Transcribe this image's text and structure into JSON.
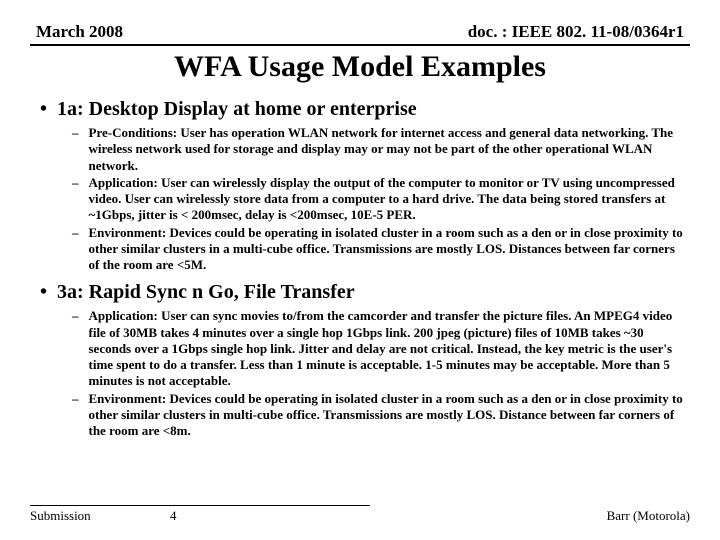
{
  "header": {
    "date": "March 2008",
    "doc": "doc. : IEEE 802. 11-08/0364r1"
  },
  "title": "WFA Usage Model Examples",
  "sections": [
    {
      "heading": "1a: Desktop Display at home or enterprise",
      "items": [
        "Pre-Conditions: User has operation WLAN network for internet access and general data networking. The wireless network used for storage and display may or may not be part of the other operational WLAN network.",
        "Application: User can wirelessly display the output of the computer to monitor or TV using uncompressed video. User can wirelessly store data from a computer to a hard drive. The data being stored transfers at ~1Gbps, jitter is < 200msec, delay is <200msec, 10E-5 PER.",
        "Environment: Devices could be operating in isolated cluster in a room such as a den or in close proximity to other similar clusters in a multi-cube office. Transmissions are mostly LOS. Distances between far corners of the room are <5M."
      ]
    },
    {
      "heading": "3a: Rapid Sync n Go, File Transfer",
      "items": [
        "Application: User can sync movies to/from the camcorder and transfer the picture files. An MPEG4 video file of 30MB takes 4 minutes over a single hop 1Gbps link. 200 jpeg (picture) files of 10MB takes ~30 seconds over a 1Gbps single hop link. Jitter and delay are not critical. Instead, the key metric is the user's time spent to do a transfer. Less than 1 minute is acceptable. 1-5 minutes may be acceptable. More than 5 minutes is not acceptable.",
        "Environment: Devices could be operating in isolated cluster in a room such as a den or in close proximity to other similar clusters in multi-cube office. Transmissions are mostly LOS. Distance between far corners of the room are <8m."
      ]
    }
  ],
  "footer": {
    "left": "Submission",
    "page": "4",
    "right": "Barr (Motorola)"
  }
}
